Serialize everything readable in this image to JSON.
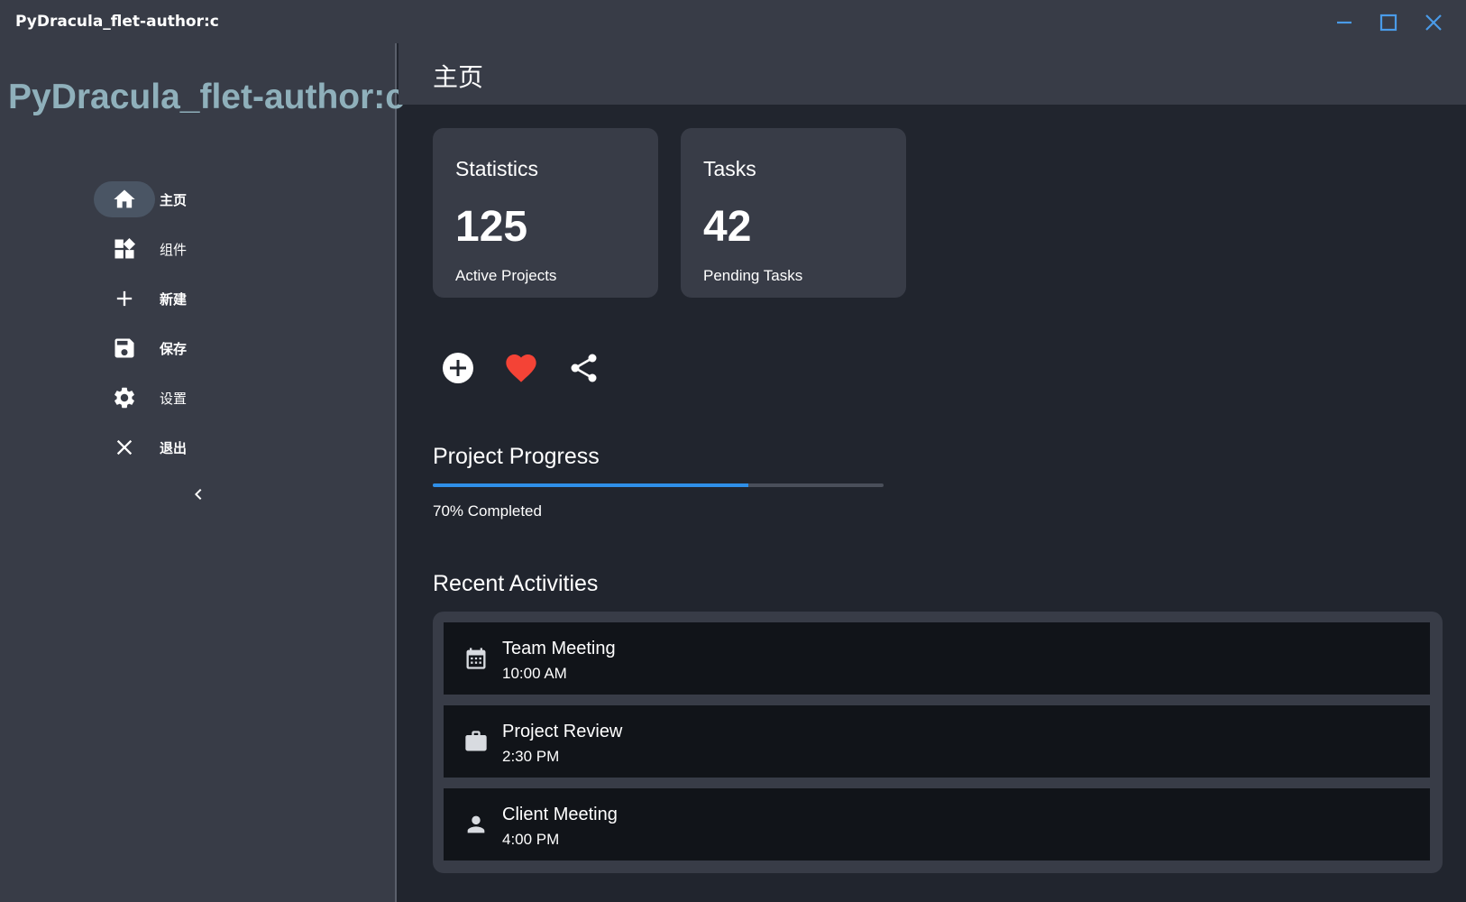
{
  "window": {
    "title": "PyDracula_flet-author:c",
    "controls": [
      "minimize-icon",
      "maximize-icon",
      "close-icon"
    ]
  },
  "sidebar": {
    "brand": "PyDracula_flet-author:c",
    "items": [
      {
        "label": "主页",
        "icon": "home-icon",
        "active": true
      },
      {
        "label": "组件",
        "icon": "widgets-icon",
        "active": false
      },
      {
        "label": "新建",
        "icon": "add-icon",
        "active": false
      },
      {
        "label": "保存",
        "icon": "save-icon",
        "active": false
      },
      {
        "label": "设置",
        "icon": "settings-icon",
        "active": false
      },
      {
        "label": "退出",
        "icon": "exit-icon",
        "active": false
      }
    ],
    "collapse_icon": "chevron-left-icon"
  },
  "header": {
    "title": "主页"
  },
  "cards": [
    {
      "title": "Statistics",
      "value": "125",
      "subtitle": "Active Projects"
    },
    {
      "title": "Tasks",
      "value": "42",
      "subtitle": "Pending Tasks"
    }
  ],
  "actions": [
    {
      "icon": "add-circle-icon",
      "color": "#ffffff"
    },
    {
      "icon": "heart-icon",
      "color": "#f44336"
    },
    {
      "icon": "share-icon",
      "color": "#ffffff"
    }
  ],
  "progress": {
    "title": "Project Progress",
    "value": 0.7,
    "label": "70% Completed",
    "color": "#2f8fe8"
  },
  "recent": {
    "title": "Recent Activities",
    "items": [
      {
        "icon": "calendar-icon",
        "title": "Team Meeting",
        "time": "10:00 AM"
      },
      {
        "icon": "briefcase-icon",
        "title": "Project Review",
        "time": "2:30 PM"
      },
      {
        "icon": "person-icon",
        "title": "Client Meeting",
        "time": "4:00 PM"
      }
    ]
  },
  "colors": {
    "background": "#21252e",
    "panel": "#383c47",
    "accent": "#2f8fe8",
    "brand_text": "#8fb0bb",
    "activity_bg": "#111419"
  }
}
